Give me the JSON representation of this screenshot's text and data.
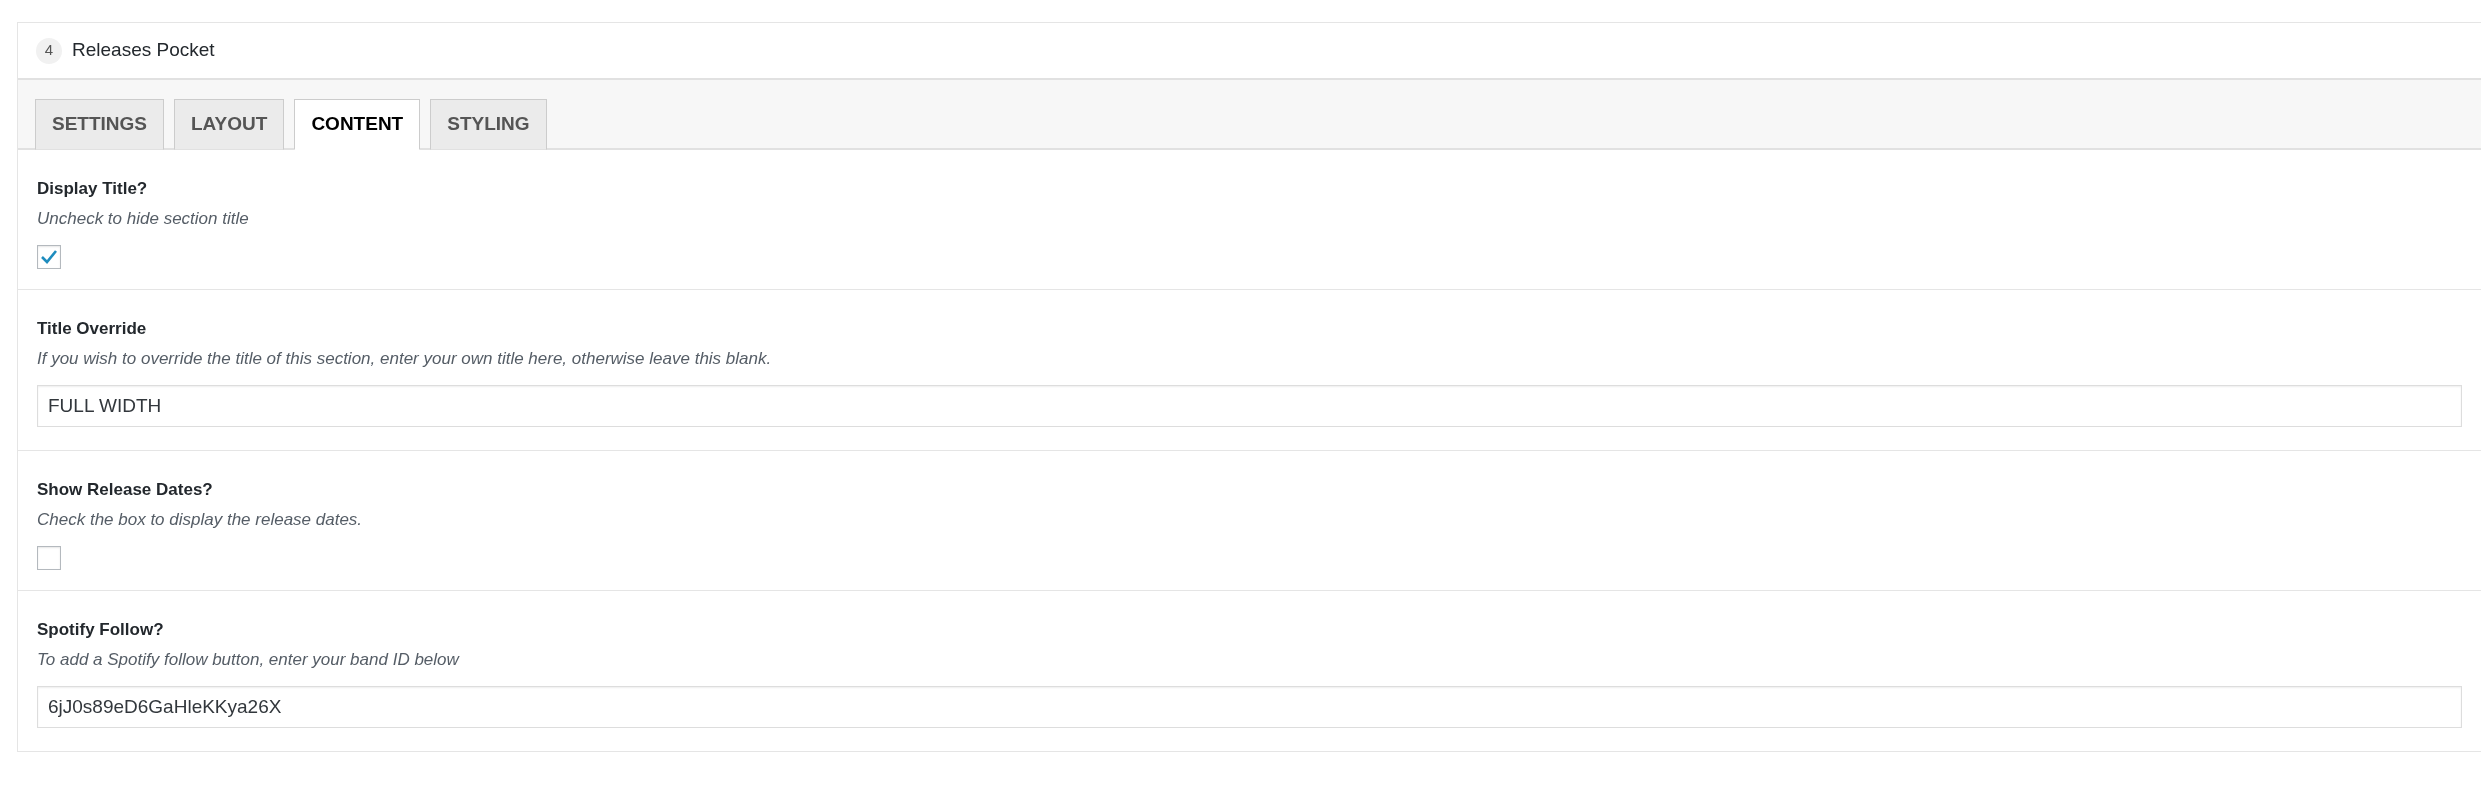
{
  "panel": {
    "number": "4",
    "title": "Releases Pocket"
  },
  "tabs": [
    {
      "label": "SETTINGS",
      "selected": false
    },
    {
      "label": "LAYOUT",
      "selected": false
    },
    {
      "label": "CONTENT",
      "selected": true
    },
    {
      "label": "STYLING",
      "selected": false
    }
  ],
  "fields": [
    {
      "kind": "checkbox",
      "label": "Display Title?",
      "description": "Uncheck to hide section title",
      "checked": true
    },
    {
      "kind": "text",
      "label": "Title Override",
      "description": "If you wish to override the title of this section, enter your own title here, otherwise leave this blank.",
      "value": "FULL WIDTH"
    },
    {
      "kind": "checkbox",
      "label": "Show Release Dates?",
      "description": "Check the box to display the release dates.",
      "checked": false
    },
    {
      "kind": "text",
      "label": "Spotify Follow?",
      "description": "To add a Spotify follow button, enter your band ID below",
      "value": "6jJ0s89eD6GaHleKKya26X"
    }
  ]
}
